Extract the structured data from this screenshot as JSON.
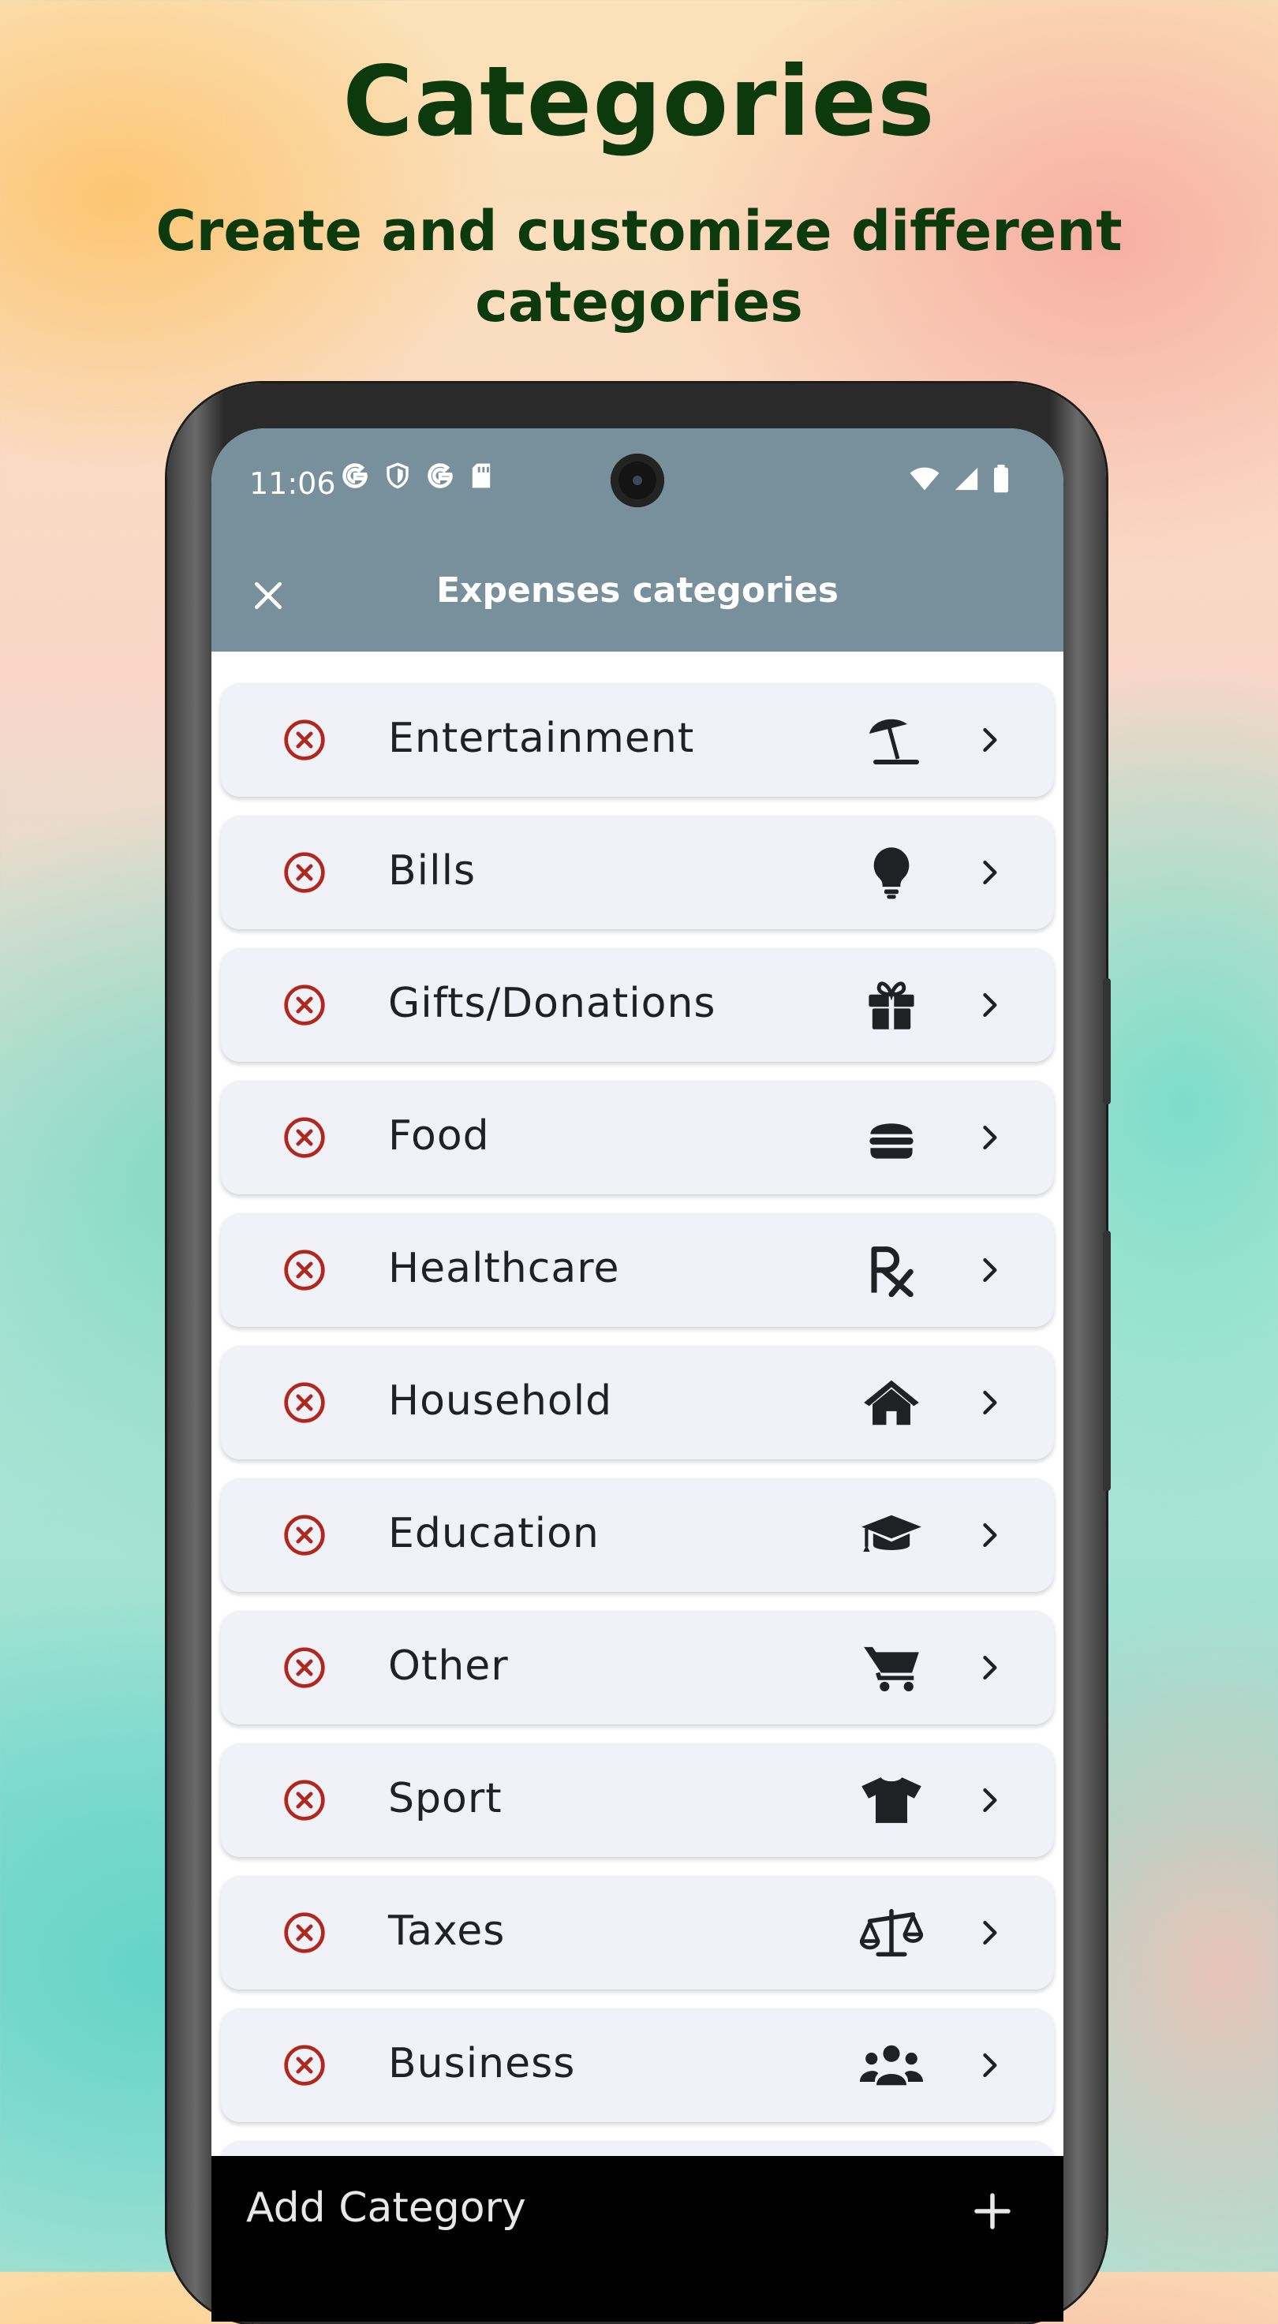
{
  "promo": {
    "title": "Categories",
    "subtitle": "Create and customize different categories"
  },
  "status_bar": {
    "time": "11:06",
    "left_icons": [
      "google-icon",
      "shield-icon",
      "google-icon",
      "sd-card-icon"
    ],
    "right_icons": [
      "wifi-icon",
      "cell-signal-icon",
      "battery-icon"
    ]
  },
  "app_bar": {
    "title": "Expenses categories",
    "close_icon": "close-icon",
    "background": "#78909c"
  },
  "categories": [
    {
      "label": "Entertainment",
      "icon": "beach-umbrella-icon"
    },
    {
      "label": "Bills",
      "icon": "lightbulb-icon"
    },
    {
      "label": "Gifts/Donations",
      "icon": "gift-icon"
    },
    {
      "label": "Food",
      "icon": "hamburger-icon"
    },
    {
      "label": "Healthcare",
      "icon": "prescription-icon"
    },
    {
      "label": "Household",
      "icon": "home-icon"
    },
    {
      "label": "Education",
      "icon": "graduation-cap-icon"
    },
    {
      "label": "Other",
      "icon": "shopping-cart-icon"
    },
    {
      "label": "Sport",
      "icon": "tshirt-icon"
    },
    {
      "label": "Taxes",
      "icon": "balance-scale-icon"
    },
    {
      "label": "Business",
      "icon": "users-icon"
    }
  ],
  "bottom_bar": {
    "label": "Add Category",
    "icon": "plus-icon"
  },
  "colors": {
    "headline": "#0c3a0c",
    "delete_icon": "#b3261e",
    "row_background": "#f0f2f7"
  }
}
